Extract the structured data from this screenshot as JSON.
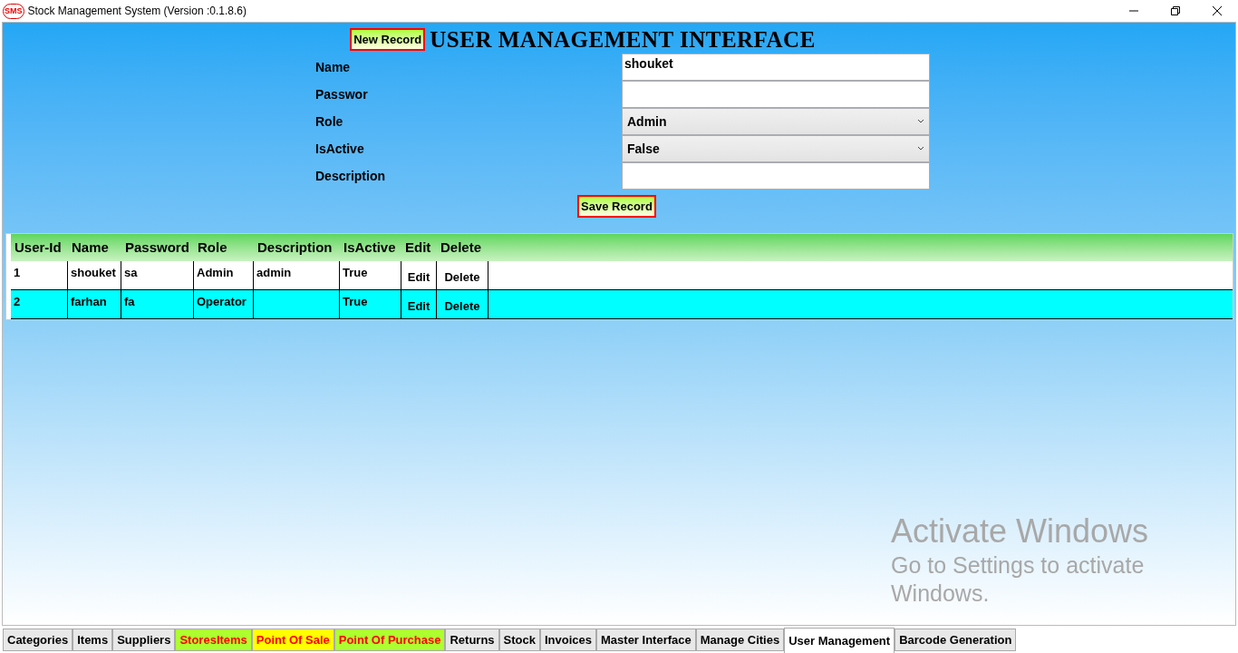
{
  "window": {
    "title": "Stock Management System (Version :0.1.8.6)",
    "logo": "SMS"
  },
  "toolbar": {
    "new_button": "New Record",
    "heading": "USER MANAGEMENT INTERFACE"
  },
  "form": {
    "fields": [
      {
        "label": "Name",
        "kind": "text",
        "value": "shouket"
      },
      {
        "label": "Passwor",
        "kind": "text"
      },
      {
        "label": "Role",
        "kind": "select",
        "value": "Admin"
      },
      {
        "label": "IsActive",
        "kind": "select",
        "value": "False"
      },
      {
        "label": "Description",
        "kind": "text"
      }
    ],
    "save_button": "Save Record"
  },
  "table": {
    "columns": [
      "User-Id",
      "Name",
      "Password",
      "Role",
      "Description",
      "IsActive",
      "Edit",
      "Delete"
    ],
    "rows": [
      {
        "selected": false,
        "cells": [
          "1",
          "shouket",
          "sa",
          "Admin",
          "admin",
          "True"
        ],
        "edit": "Edit",
        "delete": "Delete"
      },
      {
        "selected": true,
        "cells": [
          "2",
          "farhan",
          "fa",
          "Operator",
          null,
          "True"
        ],
        "edit": "Edit",
        "delete": "Delete"
      }
    ]
  },
  "os_notice": {
    "title": "Activate Windows",
    "line1": "Go to Settings to activate",
    "line2": "Windows."
  },
  "tabs": [
    {
      "label": "Categories",
      "kind": "plain",
      "selected": false
    },
    {
      "label": "Items",
      "kind": "plain",
      "selected": false
    },
    {
      "label": "Suppliers",
      "kind": "plain",
      "selected": false
    },
    {
      "label": "StoresItems",
      "kind": "green",
      "selected": false
    },
    {
      "label": "Point Of Sale",
      "kind": "yellow",
      "selected": false
    },
    {
      "label": "Point Of Purchase",
      "kind": "green",
      "selected": false
    },
    {
      "label": "Returns",
      "kind": "plain",
      "selected": false
    },
    {
      "label": "Stock",
      "kind": "plain",
      "selected": false
    },
    {
      "label": "Invoices",
      "kind": "plain",
      "selected": false
    },
    {
      "label": "Master Interface",
      "kind": "plain",
      "selected": false
    },
    {
      "label": "Manage Cities",
      "kind": "plain",
      "selected": false
    },
    {
      "label": "User Management",
      "kind": "plain",
      "selected": true
    },
    {
      "label": "Barcode Generation",
      "kind": "plain",
      "selected": false
    }
  ]
}
